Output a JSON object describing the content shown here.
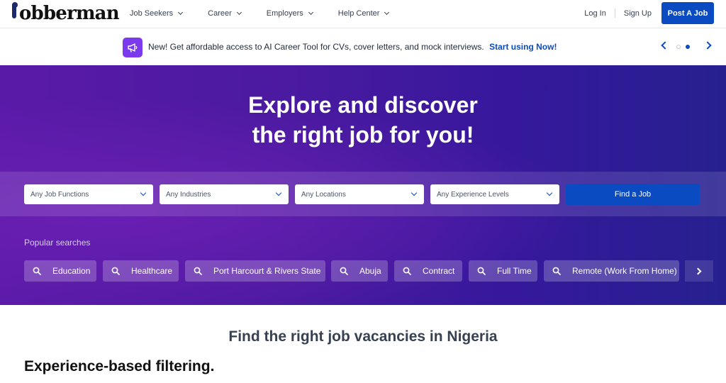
{
  "header": {
    "logo_text": "obberman",
    "nav": [
      {
        "label": "Job Seekers"
      },
      {
        "label": "Career"
      },
      {
        "label": "Employers"
      },
      {
        "label": "Help Center"
      }
    ],
    "login": "Log In",
    "signup": "Sign Up",
    "post_job": "Post A Job"
  },
  "announcement": {
    "text": "New! Get affordable access to AI Career Tool for CVs, cover letters, and mock interviews.",
    "cta": "Start using Now!",
    "active_slide": 2,
    "slide_count": 2
  },
  "hero": {
    "title_line1": "Explore and discover",
    "title_line2": "the right job for you!",
    "filters": [
      {
        "placeholder": "Any Job Functions"
      },
      {
        "placeholder": "Any Industries"
      },
      {
        "placeholder": "Any Locations"
      },
      {
        "placeholder": "Any Experience Levels"
      }
    ],
    "find_button": "Find a Job",
    "popular_label": "Popular searches",
    "popular": [
      "Education",
      "Healthcare",
      "Port Harcourt & Rivers State",
      "Abuja",
      "Contract",
      "Full Time",
      "Remote (Work From Home)"
    ]
  },
  "content": {
    "section_title": "Find the right job vacancies in Nigeria",
    "sub_title": "Experience-based filtering."
  },
  "colors": {
    "brand_blue": "#0a4bc2",
    "hero_purple": "#4a1aa0",
    "announcement_icon": "#7c3aed"
  }
}
